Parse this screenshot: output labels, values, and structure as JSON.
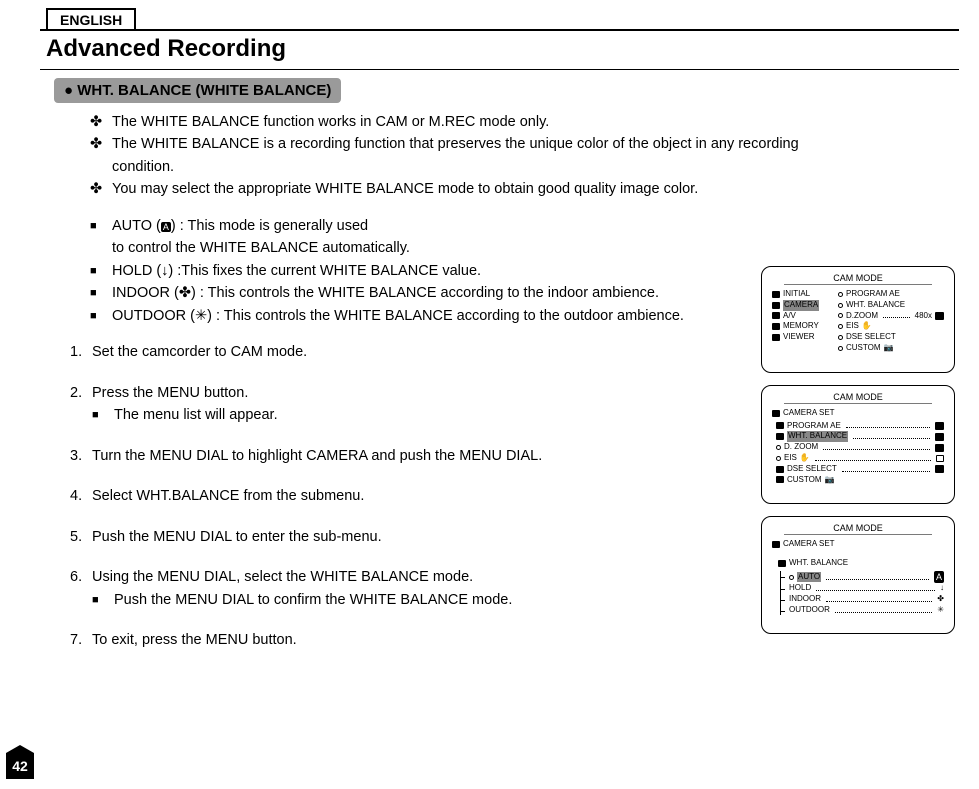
{
  "lang_tab": "ENGLISH",
  "title": "Advanced Recording",
  "section": "WHT. BALANCE (WHITE BALANCE)",
  "intro": [
    "The WHITE BALANCE function works in CAM or M.REC mode only.",
    "The WHITE BALANCE is a recording function that preserves the unique color of the object in any recording condition.",
    "You may select the appropriate WHITE BALANCE mode to obtain good quality image color."
  ],
  "modes": {
    "auto_pre": "AUTO (",
    "auto_post": ") : This mode is generally used",
    "auto_line2": "to control the WHITE BALANCE automatically.",
    "hold_pre": "HOLD (",
    "hold_post": ") :This fixes the current WHITE BALANCE value.",
    "indoor_pre": "INDOOR (",
    "indoor_post": ") : This controls the WHITE BALANCE according to the indoor ambience.",
    "outdoor_pre": "OUTDOOR (",
    "outdoor_post": ") : This controls the WHITE BALANCE according to the outdoor ambience."
  },
  "steps": [
    {
      "text": "Set the camcorder to CAM mode."
    },
    {
      "text": "Press the MENU button.",
      "sub": [
        "The menu list will appear."
      ]
    },
    {
      "text": "Turn the MENU DIAL to highlight CAMERA and push the MENU DIAL."
    },
    {
      "text": "Select WHT.BALANCE from the submenu."
    },
    {
      "text": "Push the MENU DIAL to enter the sub-menu."
    },
    {
      "text": "Using the MENU DIAL, select the WHITE BALANCE mode.",
      "sub": [
        "Push the MENU DIAL to confirm the WHITE BALANCE mode."
      ]
    },
    {
      "text": "To exit, press the MENU button."
    }
  ],
  "panel1": {
    "title": "CAM MODE",
    "left": [
      "INITIAL",
      "CAMERA",
      "A/V",
      "MEMORY",
      "VIEWER"
    ],
    "right_items": [
      "PROGRAM AE",
      "WHT. BALANCE",
      "D.ZOOM",
      "EIS",
      "DSE SELECT",
      "CUSTOM"
    ],
    "dzoom_val": "480x"
  },
  "panel2": {
    "title": "CAM MODE",
    "heading": "CAMERA SET",
    "items": [
      "PROGRAM AE",
      "WHT. BALANCE",
      "D. ZOOM",
      "EIS",
      "DSE SELECT",
      "CUSTOM"
    ]
  },
  "panel3": {
    "title": "CAM MODE",
    "heading": "CAMERA SET",
    "subheading": "WHT. BALANCE",
    "options": [
      "AUTO",
      "HOLD",
      "INDOOR",
      "OUTDOOR"
    ]
  },
  "page": "42"
}
